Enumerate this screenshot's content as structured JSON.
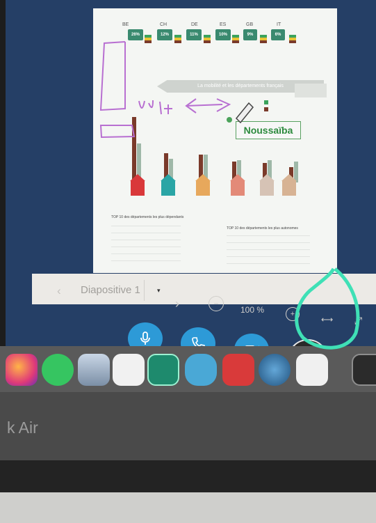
{
  "slide": {
    "countries": [
      "BE",
      "CH",
      "DE",
      "ES",
      "GB",
      "IT"
    ],
    "badges": [
      "26%",
      "12%",
      "11%",
      "10%",
      "9%",
      "6%"
    ],
    "banner_title": "La mobilité et les départements français",
    "signature": "Noussaïba",
    "top10_left_title": "TOP 10 des départements les plus dépendants",
    "top10_right_title": "TOP 10 des départements les plus autonomes"
  },
  "toolbar": {
    "prev_icon": "chevron-left-icon",
    "slide_select_value": "Diapositive 1",
    "select_caret": "▾",
    "next_icon": "chevron-right-icon",
    "zoom_out_icon": "zoom-out-icon",
    "zoom_level": "100 %",
    "zoom_in_icon": "zoom-in-icon",
    "fit_width_icon": "fit-width-icon",
    "fullscreen_icon": "fullscreen-icon"
  },
  "call_controls": {
    "mic_icon": "microphone-icon",
    "phone_icon": "phone-icon",
    "camera_icon": "video-camera-icon",
    "share_icon": "stop-share-icon",
    "accent_color": "#2d9ad7"
  },
  "dock": {
    "apps": [
      "firefox-icon",
      "whatsapp-icon",
      "preview-icon",
      "filezilla-icon",
      "xnconvert-icon",
      "shape-icon",
      "zotero-icon",
      "quicktime-icon",
      "keynote-icon",
      "terminal-icon"
    ]
  },
  "bezel": {
    "model_text": "k Air"
  },
  "annotations": {
    "ink_color": "#b86fd1",
    "highlight_color": "#3fe0b6"
  }
}
